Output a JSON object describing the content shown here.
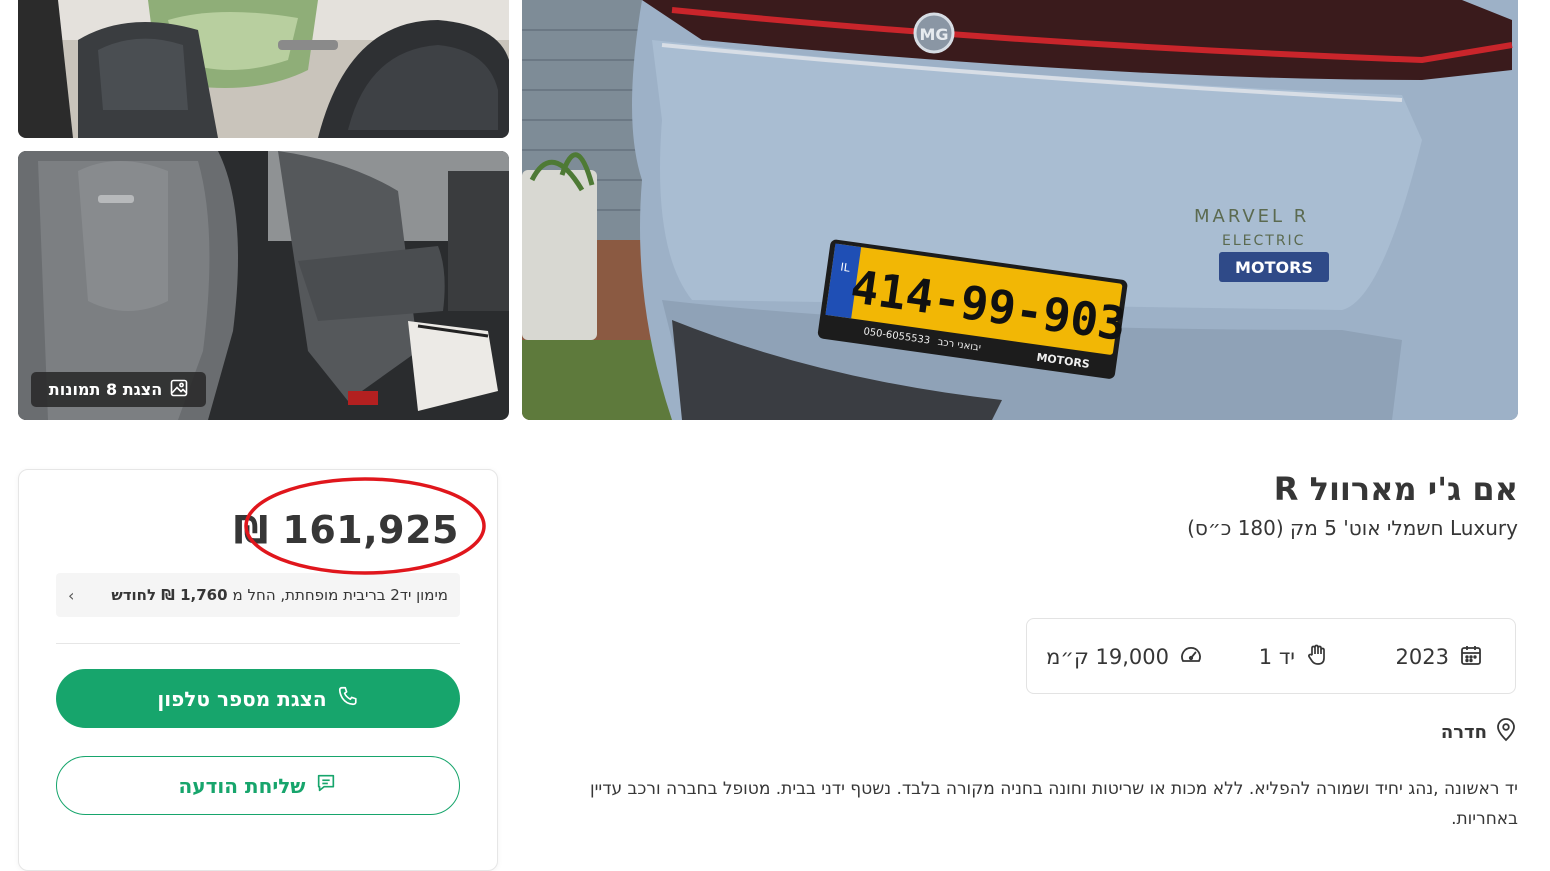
{
  "gallery": {
    "show_photos_label": "הצגת 8 תמונות",
    "plate": {
      "number": "414-99-903",
      "country_code": "IL",
      "phone": "050-6055533",
      "dealer_text": "יבואני רכב",
      "dealer_brand": "MOTORS"
    },
    "badge_model": "MARVEL R",
    "badge_sub": "ELECTRIC",
    "badge_dealer": "MOTORS",
    "brand_logo": "MG"
  },
  "price_card": {
    "price": "161,925 ₪",
    "finance": {
      "prefix": "מימון יד2 בריבית מופחתת, החל מ",
      "amount": "1,760 ₪ לחודש"
    },
    "phone_button": "הצגת מספר טלפון",
    "message_button": "שליחת הודעה"
  },
  "listing": {
    "title": "אם ג'י מארוול R",
    "subtitle": "Luxury חשמלי אוט' 5 מק (180 כ״ס)",
    "specs": {
      "year": "2023",
      "hand": "יד 1",
      "mileage": "19,000 ק״מ"
    },
    "location": "חדרה",
    "description": "יד ראשונה ,נהג יחיד ושמורה להפליא. ללא מכות או שריטות וחונה בחניה מקורה בלבד. נשטף ידני בבית. מטופל בחברה ורכב עדיין באחריות."
  },
  "colors": {
    "accent_green": "#17a56c",
    "highlight_red": "#e0161c",
    "text": "#363636"
  },
  "icons": {
    "photos": "image-icon",
    "phone": "phone-icon",
    "message": "chat-icon",
    "year": "calendar-icon",
    "hand": "hand-icon",
    "mileage": "speedometer-icon",
    "location": "map-pin-icon"
  }
}
